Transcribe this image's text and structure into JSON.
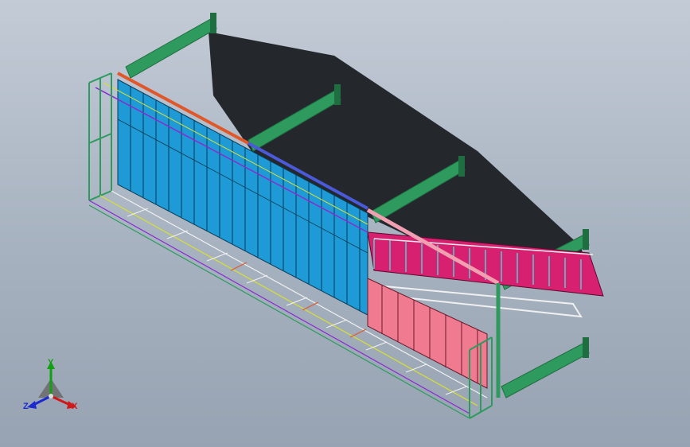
{
  "viewport": {
    "background": "#a9b4c2"
  },
  "triad": {
    "y_label": "Y",
    "x_label": "X",
    "z_label": "Z",
    "colors": {
      "x": "#d01818",
      "y": "#12a012",
      "z": "#1a2ad0"
    }
  },
  "model": {
    "colors": {
      "beam": "#2e9a5e",
      "beam_dark": "#1f6e41",
      "glass_blue": "#1e9bd6",
      "glass_pink_light": "#f07a90",
      "glass_magenta": "#d82070",
      "rail_orange": "#e0582a",
      "rail_blue": "#4a5ad8",
      "rail_pink": "#f0a0b0",
      "frame_purple": "#8a2ad0",
      "frame_yellow": "#d8e030",
      "frame_white": "#f0f0f0",
      "shadow": "#24282d"
    }
  }
}
